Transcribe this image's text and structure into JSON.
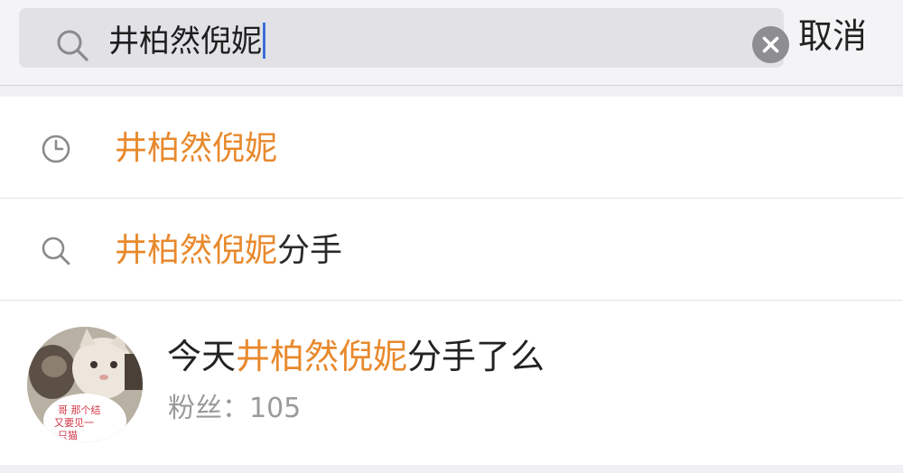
{
  "search": {
    "query": "井柏然倪妮",
    "cancel_label": "取消"
  },
  "suggestions": [
    {
      "type": "history",
      "icon": "clock-icon",
      "highlight": "井柏然倪妮",
      "rest": ""
    },
    {
      "type": "search",
      "icon": "search-icon",
      "highlight": "井柏然倪妮",
      "rest": "分手"
    }
  ],
  "user_result": {
    "name_prefix": "今天",
    "name_highlight": "井柏然倪妮",
    "name_suffix": "分手了么",
    "fans_label": "粉丝：",
    "fans_count": "105",
    "avatar_caption": "哥 那个结 又要见一 只猫"
  },
  "colors": {
    "highlight": "#e8892c",
    "caret": "#3b6fd8"
  }
}
